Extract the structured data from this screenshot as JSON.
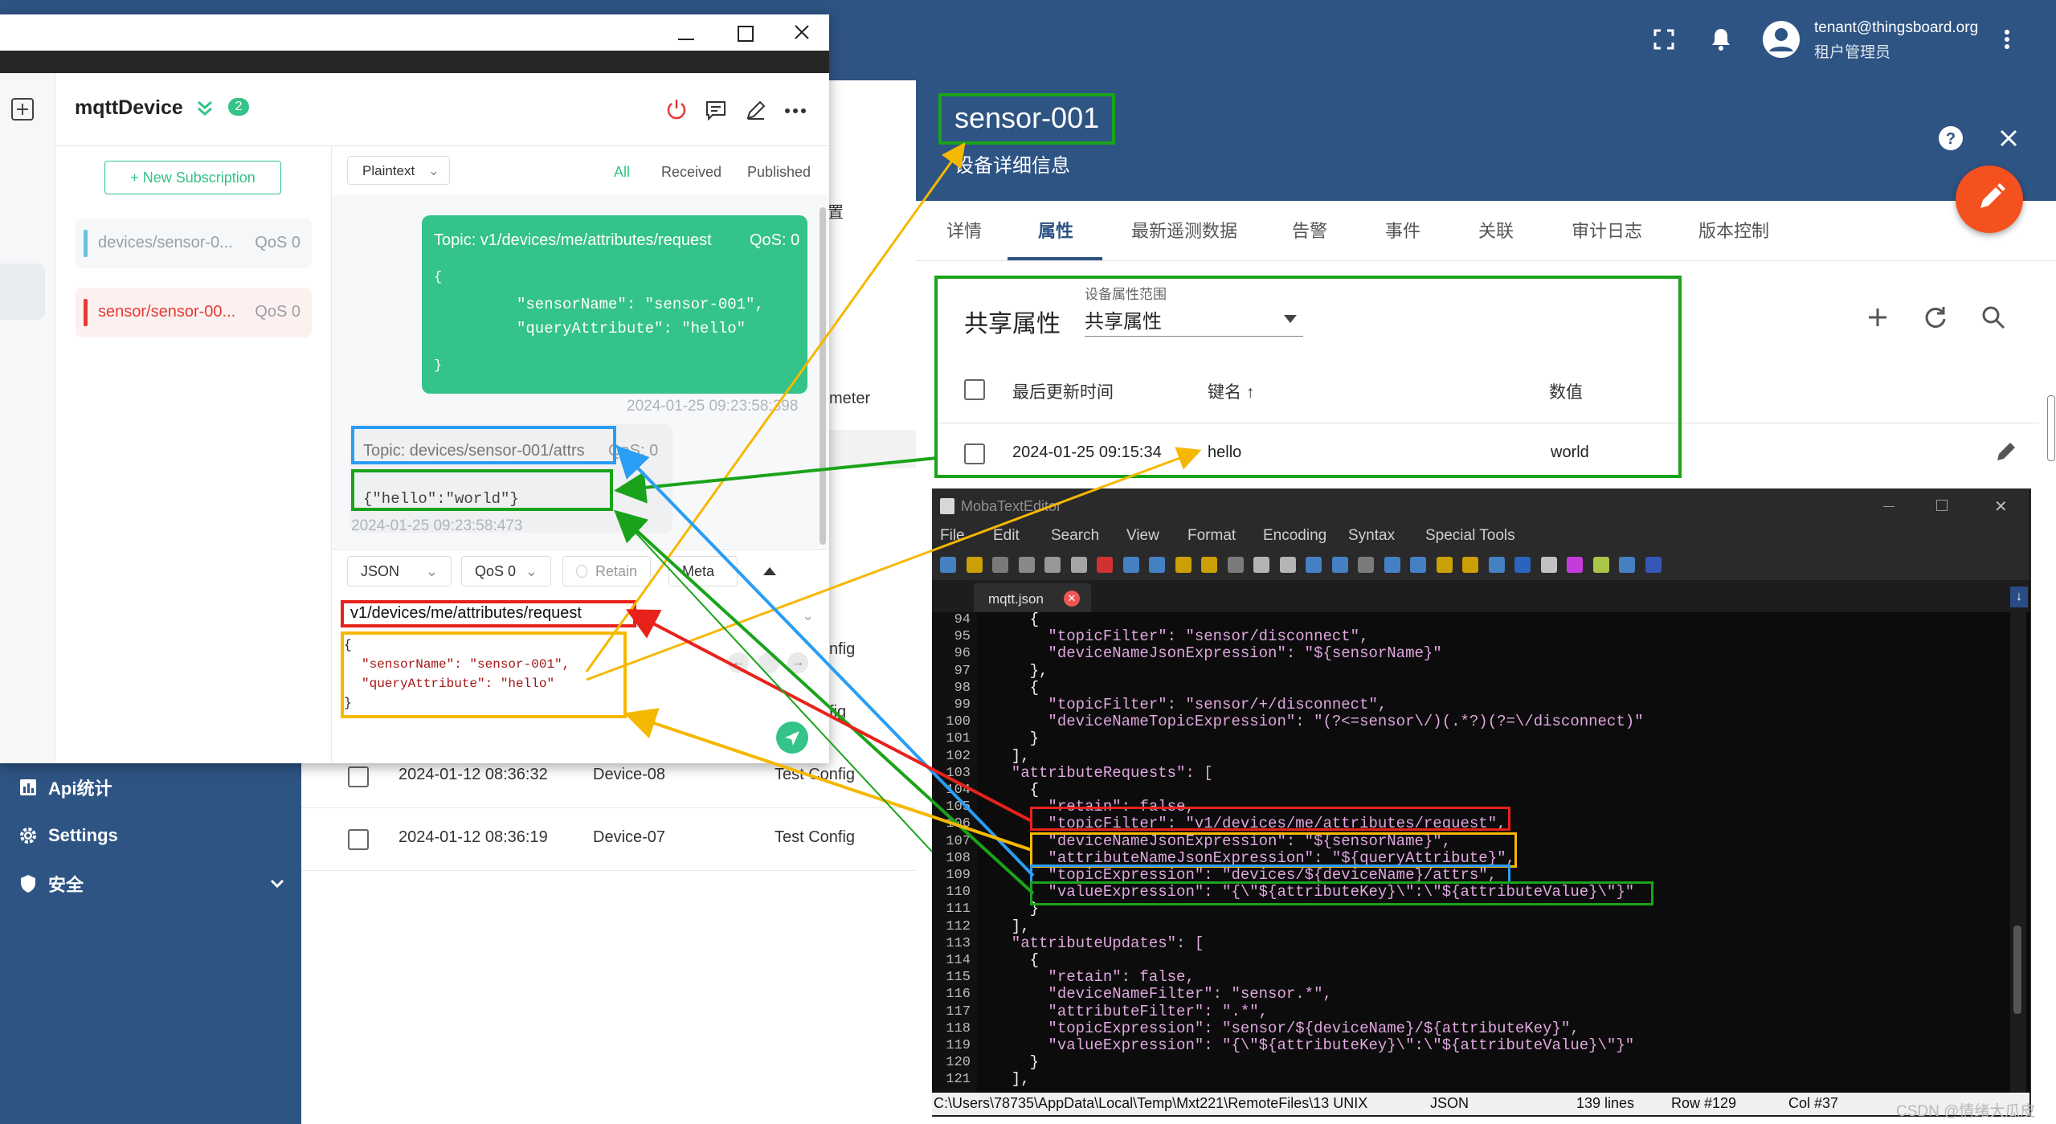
{
  "tb": {
    "user_email": "tenant@thingsboard.org",
    "user_role": "租户管理员",
    "sidebar": [
      {
        "label": "Api统计",
        "icon": "chart-icon"
      },
      {
        "label": "Settings",
        "icon": "gear-icon"
      },
      {
        "label": "安全",
        "icon": "shield-icon"
      }
    ],
    "list_fragments": {
      "s1": "置",
      "s2": "meter",
      "s3": "nfig",
      "s4": "fig"
    },
    "rows": [
      {
        "time": "2024-01-12 08:36:32",
        "name": "Device-08",
        "profile": "Test Config"
      },
      {
        "time": "2024-01-12 08:36:19",
        "name": "Device-07",
        "profile": "Test Config"
      }
    ]
  },
  "detail": {
    "title": "sensor-001",
    "subtitle": "设备详细信息",
    "tabs": [
      "详情",
      "属性",
      "最新遥测数据",
      "告警",
      "事件",
      "关联",
      "审计日志",
      "版本控制"
    ],
    "active_tab": "属性",
    "attr_heading": "共享属性",
    "scope_label": "设备属性范围",
    "scope_value": "共享属性",
    "columns": [
      "最后更新时间",
      "键名 ↑",
      "数值"
    ],
    "row": {
      "time": "2024-01-25 09:15:34",
      "key": "hello",
      "value": "world"
    }
  },
  "mqttx": {
    "connection_name": "mqttDevice",
    "badge": "2",
    "new_sub_label": "+ New Subscription",
    "subs": [
      {
        "topic": "devices/sensor-0...",
        "qos": "QoS 0",
        "color": "#6ec1e4"
      },
      {
        "topic": "sensor/sensor-00...",
        "qos": "QoS 0",
        "color": "#e53935"
      }
    ],
    "format": "Plaintext",
    "filters": [
      "All",
      "Received",
      "Published"
    ],
    "sent": {
      "topic": "Topic: v1/devices/me/attributes/request",
      "qos": "QoS: 0",
      "l1": "{",
      "l2": "\"sensorName\": \"sensor-001\",",
      "l3": "\"queryAttribute\": \"hello\"",
      "l4": "}",
      "time": "2024-01-25 09:23:58:398"
    },
    "received": {
      "topic": "Topic: devices/sensor-001/attrs",
      "qos": "QoS: 0",
      "payload": "{\"hello\":\"world\"}",
      "time": "2024-01-25 09:23:58:473"
    },
    "payload_type": "JSON",
    "qos_select": "QoS 0",
    "retain": "Retain",
    "meta": "Meta",
    "topic_input": "v1/devices/me/attributes/request",
    "payload_lines": [
      "{",
      "\"sensorName\": \"sensor-001\",",
      "\"queryAttribute\": \"hello\"",
      "}"
    ]
  },
  "moba": {
    "title": "MobaTextEditor",
    "menu": [
      "File",
      "Edit",
      "Search",
      "View",
      "Format",
      "Encoding",
      "Syntax",
      "Special Tools"
    ],
    "tab": "mqtt.json",
    "lines": [
      {
        "n": "94",
        "t": "    {"
      },
      {
        "n": "95",
        "t": "      \"topicFilter\": \"sensor/disconnect\","
      },
      {
        "n": "96",
        "t": "      \"deviceNameJsonExpression\": \"${sensorName}\""
      },
      {
        "n": "97",
        "t": "    },"
      },
      {
        "n": "98",
        "t": "    {"
      },
      {
        "n": "99",
        "t": "      \"topicFilter\": \"sensor/+/disconnect\","
      },
      {
        "n": "100",
        "t": "      \"deviceNameTopicExpression\": \"(?<=sensor\\/)(.*?)(?=\\/disconnect)\""
      },
      {
        "n": "101",
        "t": "    }"
      },
      {
        "n": "102",
        "t": "  ],"
      },
      {
        "n": "103",
        "t": "  \"attributeRequests\": ["
      },
      {
        "n": "104",
        "t": "    {"
      },
      {
        "n": "105",
        "t": "      \"retain\": false,"
      },
      {
        "n": "106",
        "t": "      \"topicFilter\": \"v1/devices/me/attributes/request\","
      },
      {
        "n": "107",
        "t": "      \"deviceNameJsonExpression\": \"${sensorName}\","
      },
      {
        "n": "108",
        "t": "      \"attributeNameJsonExpression\": \"${queryAttribute}\","
      },
      {
        "n": "109",
        "t": "      \"topicExpression\": \"devices/${deviceName}/attrs\","
      },
      {
        "n": "110",
        "t": "      \"valueExpression\": \"{\\\"${attributeKey}\\\":\\\"${attributeValue}\\\"}\""
      },
      {
        "n": "111",
        "t": "    }"
      },
      {
        "n": "112",
        "t": "  ],"
      },
      {
        "n": "113",
        "t": "  \"attributeUpdates\": ["
      },
      {
        "n": "114",
        "t": "    {"
      },
      {
        "n": "115",
        "t": "      \"retain\": false,"
      },
      {
        "n": "116",
        "t": "      \"deviceNameFilter\": \"sensor.*\","
      },
      {
        "n": "117",
        "t": "      \"attributeFilter\": \".*\","
      },
      {
        "n": "118",
        "t": "      \"topicExpression\": \"sensor/${deviceName}/${attributeKey}\","
      },
      {
        "n": "119",
        "t": "      \"valueExpression\": \"{\\\"${attributeKey}\\\":\\\"${attributeValue}\\\"}\""
      },
      {
        "n": "120",
        "t": "    }"
      },
      {
        "n": "121",
        "t": "  ],"
      }
    ],
    "status": {
      "path": "C:\\Users\\78735\\AppData\\Local\\Temp\\Mxt221\\RemoteFiles\\13 UNIX",
      "syntax": "JSON",
      "lines": "139 lines",
      "row": "Row #129",
      "col": "Col #37"
    }
  },
  "watermark": "CSDN @情绪大瓜皮",
  "colors": {
    "tb_blue": "#2e5484",
    "mqttx_green": "#34c388",
    "annot_red": "#e8221b",
    "annot_yellow": "#f5b800",
    "annot_blue": "#2a9df4",
    "annot_green": "#1aa31a",
    "fab_orange": "#f4511e"
  }
}
